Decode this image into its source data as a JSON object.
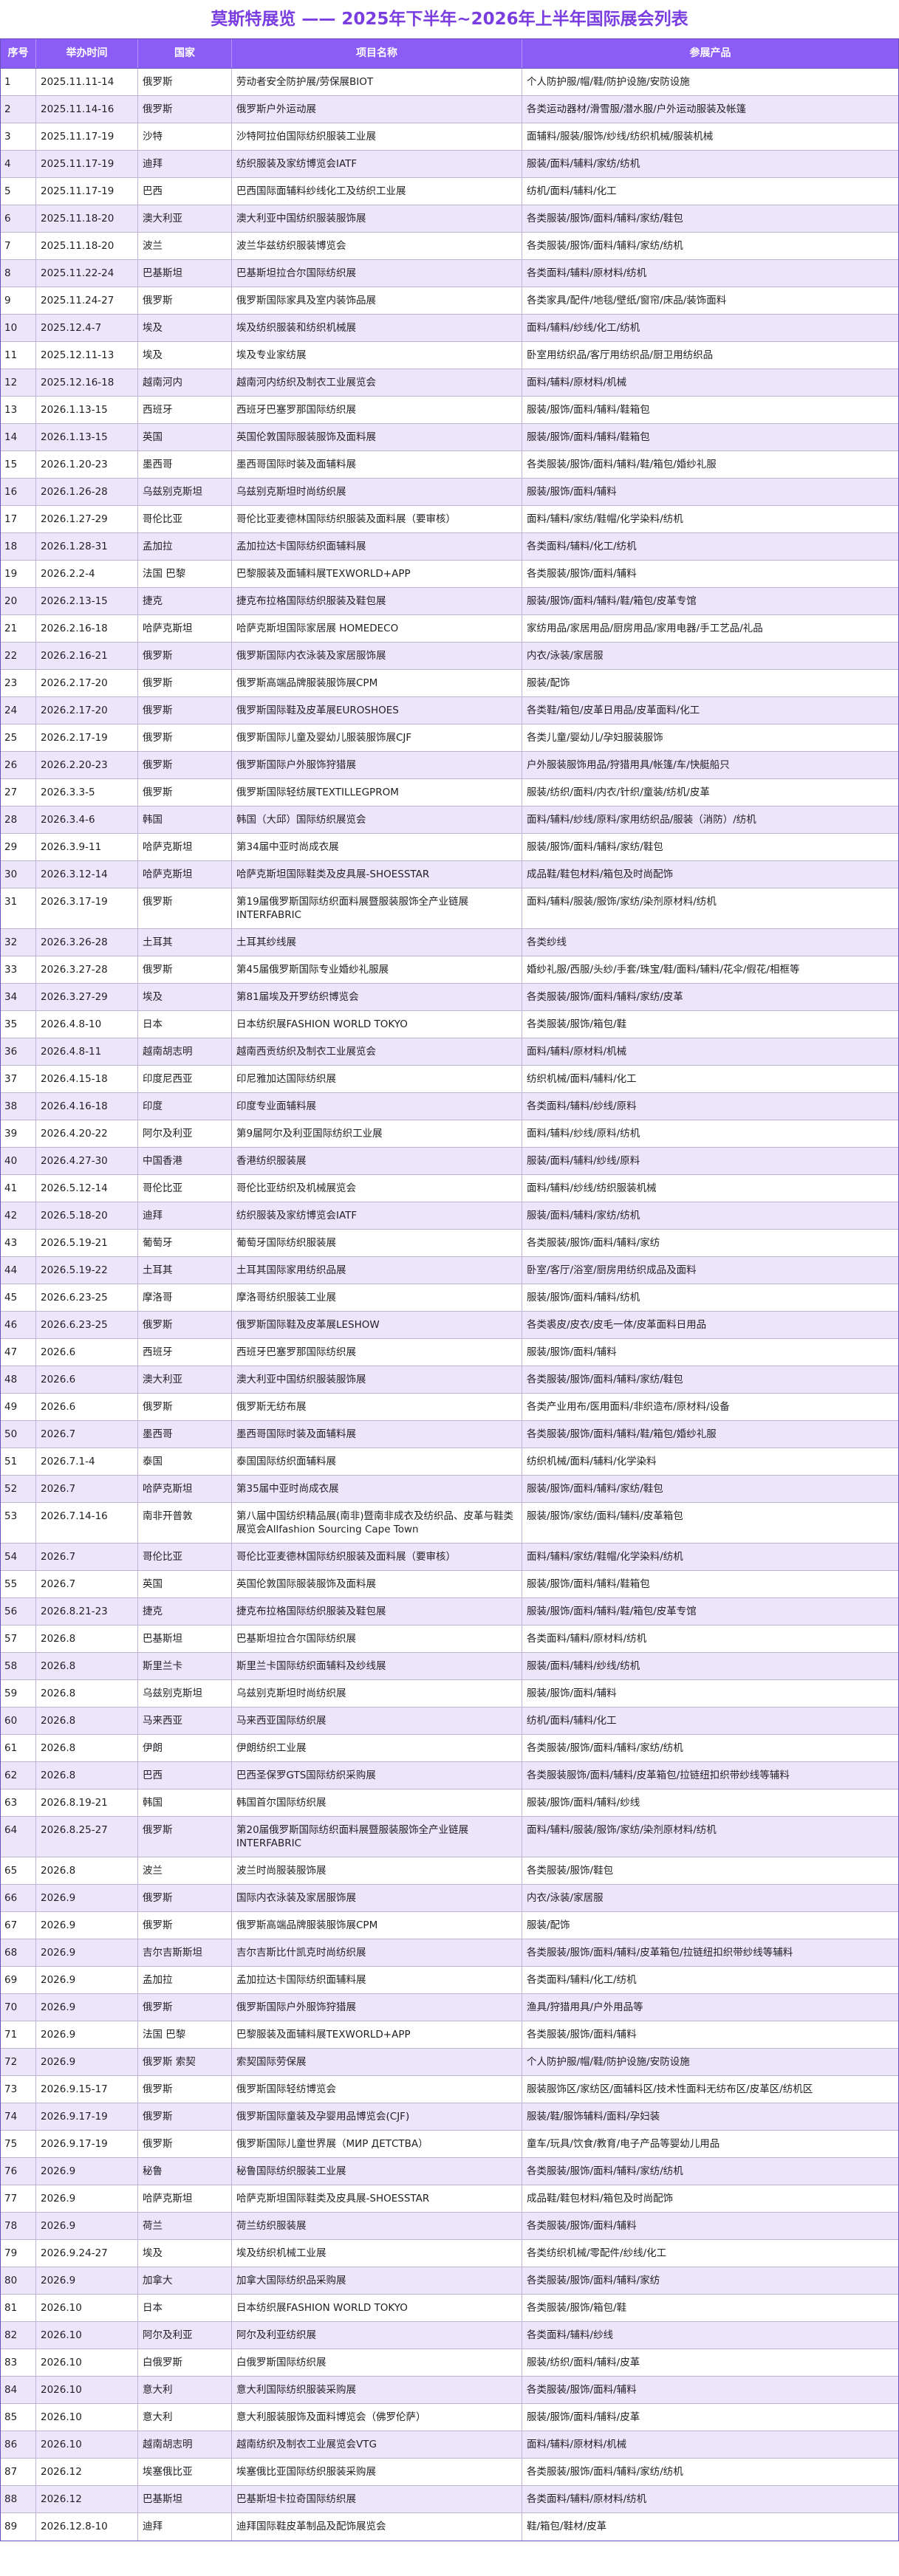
{
  "page": {
    "title": "莫斯特展览 —— 2025年下半年~2026年上半年国际展会列表"
  },
  "colors": {
    "title": "#7a3de0",
    "header_bg": "#8b5cf6",
    "header_text": "#ffffff",
    "stripe": "#ede6fb",
    "border": "#bdb3d6",
    "border_strong": "#6a4fc0"
  },
  "table": {
    "columns": [
      "序号",
      "举办时间",
      "国家",
      "项目名称",
      "参展产品"
    ],
    "rows": [
      [
        "1",
        "2025.11.11-14",
        "俄罗斯",
        "劳动者安全防护展/劳保展BIOT",
        "个人防护服/帽/鞋/防护设施/安防设施"
      ],
      [
        "2",
        "2025.11.14-16",
        "俄罗斯",
        "俄罗斯户外运动展",
        "各类运动器材/滑雪服/潜水服/户外运动服装及帐篷"
      ],
      [
        "3",
        "2025.11.17-19",
        "沙特",
        "沙特阿拉伯国际纺织服装工业展",
        "面辅料/服装/服饰/纱线/纺织机械/服装机械"
      ],
      [
        "4",
        "2025.11.17-19",
        "迪拜",
        "纺织服装及家纺博览会IATF",
        "服装/面料/辅料/家纺/纺机"
      ],
      [
        "5",
        "2025.11.17-19",
        "巴西",
        "巴西国际面辅料纱线化工及纺织工业展",
        "纺机/面料/辅料/化工"
      ],
      [
        "6",
        "2025.11.18-20",
        "澳大利亚",
        "澳大利亚中国纺织服装服饰展",
        "各类服装/服饰/面料/辅料/家纺/鞋包"
      ],
      [
        "7",
        "2025.11.18-20",
        "波兰",
        "波兰华兹纺织服装博览会",
        "各类服装/服饰/面料/辅料/家纺/纺机"
      ],
      [
        "8",
        "2025.11.22-24",
        "巴基斯坦",
        "巴基斯坦拉合尔国际纺织展",
        "各类面料/辅料/原材料/纺机"
      ],
      [
        "9",
        "2025.11.24-27",
        "俄罗斯",
        "俄罗斯国际家具及室内装饰品展",
        "各类家具/配件/地毯/壁纸/窗帘/床品/装饰面料"
      ],
      [
        "10",
        "2025.12.4-7",
        "埃及",
        "埃及纺织服装和纺织机械展",
        "面料/辅料/纱线/化工/纺机"
      ],
      [
        "11",
        "2025.12.11-13",
        "埃及",
        "埃及专业家纺展",
        "卧室用纺织品/客厅用纺织品/厨卫用纺织品"
      ],
      [
        "12",
        "2025.12.16-18",
        "越南河内",
        "越南河内纺织及制衣工业展览会",
        "面料/辅料/原材料/机械"
      ],
      [
        "13",
        "2026.1.13-15",
        "西班牙",
        "西班牙巴塞罗那国际纺织展",
        "服装/服饰/面料/辅料/鞋箱包"
      ],
      [
        "14",
        "2026.1.13-15",
        "英国",
        "英国伦敦国际服装服饰及面料展",
        "服装/服饰/面料/辅料/鞋箱包"
      ],
      [
        "15",
        "2026.1.20-23",
        "墨西哥",
        "墨西哥国际时装及面辅料展",
        "各类服装/服饰/面料/辅料/鞋/箱包/婚纱礼服"
      ],
      [
        "16",
        "2026.1.26-28",
        "乌兹别克斯坦",
        "乌兹别克斯坦时尚纺织展",
        "服装/服饰/面料/辅料"
      ],
      [
        "17",
        "2026.1.27-29",
        "哥伦比亚",
        "哥伦比亚麦德林国际纺织服装及面料展（要审核）",
        "面料/辅料/家纺/鞋帽/化学染料/纺机"
      ],
      [
        "18",
        "2026.1.28-31",
        "孟加拉",
        "孟加拉达卡国际纺织面辅料展",
        "各类面料/辅料/化工/纺机"
      ],
      [
        "19",
        "2026.2.2-4",
        "法国 巴黎",
        "巴黎服装及面辅料展TEXWORLD+APP",
        "各类服装/服饰/面料/辅料"
      ],
      [
        "20",
        "2026.2.13-15",
        "捷克",
        "捷克布拉格国际纺织服装及鞋包展",
        "服装/服饰/面料/辅料/鞋/箱包/皮革专馆"
      ],
      [
        "21",
        "2026.2.16-18",
        "哈萨克斯坦",
        "哈萨克斯坦国际家居展 HOMEDECO",
        "家纺用品/家居用品/厨房用品/家用电器/手工艺品/礼品"
      ],
      [
        "22",
        "2026.2.16-21",
        "俄罗斯",
        "俄罗斯国际内衣泳装及家居服饰展",
        "内衣/泳装/家居服"
      ],
      [
        "23",
        "2026.2.17-20",
        "俄罗斯",
        "俄罗斯高端品牌服装服饰展CPM",
        "服装/配饰"
      ],
      [
        "24",
        "2026.2.17-20",
        "俄罗斯",
        "俄罗斯国际鞋及皮革展EUROSHOES",
        "各类鞋/箱包/皮革日用品/皮革面料/化工"
      ],
      [
        "25",
        "2026.2.17-19",
        "俄罗斯",
        "俄罗斯国际儿童及婴幼儿服装服饰展CJF",
        "各类儿童/婴幼儿/孕妇服装服饰"
      ],
      [
        "26",
        "2026.2.20-23",
        "俄罗斯",
        "俄罗斯国际户外服饰狩猎展",
        "户外服装服饰用品/狩猎用具/帐篷/车/快艇船只"
      ],
      [
        "27",
        "2026.3.3-5",
        "俄罗斯",
        "俄罗斯国际轻纺展TEXTILLEGPROM",
        "服装/纺织/面料/内衣/针织/童装/纺机/皮革"
      ],
      [
        "28",
        "2026.3.4-6",
        "韩国",
        "韩国（大邱）国际纺织展览会",
        "面料/辅料/纱线/原料/家用纺织品/服装（消防）/纺机"
      ],
      [
        "29",
        "2026.3.9-11",
        "哈萨克斯坦",
        "第34届中亚时尚成衣展",
        "服装/服饰/面料/辅料/家纺/鞋包"
      ],
      [
        "30",
        "2026.3.12-14",
        "哈萨克斯坦",
        "哈萨克斯坦国际鞋类及皮具展-SHOESSTAR",
        "成品鞋/鞋包材料/箱包及时尚配饰"
      ],
      [
        "31",
        "2026.3.17-19",
        "俄罗斯",
        "第19届俄罗斯国际纺织面料展暨服装服饰全产业链展INTERFABRIC",
        "面料/辅料/服装/服饰/家纺/染剂原材料/纺机"
      ],
      [
        "32",
        "2026.3.26-28",
        "土耳其",
        "土耳其纱线展",
        "各类纱线"
      ],
      [
        "33",
        "2026.3.27-28",
        "俄罗斯",
        "第45届俄罗斯国际专业婚纱礼服展",
        "婚纱礼服/西服/头纱/手套/珠宝/鞋/面料/辅料/花伞/假花/相框等"
      ],
      [
        "34",
        "2026.3.27-29",
        "埃及",
        "第81届埃及开罗纺织博览会",
        "各类服装/服饰/面料/辅料/家纺/皮革"
      ],
      [
        "35",
        "2026.4.8-10",
        "日本",
        "日本纺织展FASHION WORLD TOKYO",
        "各类服装/服饰/箱包/鞋"
      ],
      [
        "36",
        "2026.4.8-11",
        "越南胡志明",
        "越南西贡纺织及制衣工业展览会",
        "面料/辅料/原材料/机械"
      ],
      [
        "37",
        "2026.4.15-18",
        "印度尼西亚",
        "印尼雅加达国际纺织展",
        "纺织机械/面料/辅料/化工"
      ],
      [
        "38",
        "2026.4.16-18",
        "印度",
        "印度专业面辅料展",
        "各类面料/辅料/纱线/原料"
      ],
      [
        "39",
        "2026.4.20-22",
        "阿尔及利亚",
        "第9届阿尔及利亚国际纺织工业展",
        "面料/辅料/纱线/原料/纺机"
      ],
      [
        "40",
        "2026.4.27-30",
        "中国香港",
        "香港纺织服装展",
        "服装/面料/辅料/纱线/原料"
      ],
      [
        "41",
        "2026.5.12-14",
        "哥伦比亚",
        "哥伦比亚纺织及机械展览会",
        "面料/辅料/纱线/纺织服装机械"
      ],
      [
        "42",
        "2026.5.18-20",
        "迪拜",
        "纺织服装及家纺博览会IATF",
        "服装/面料/辅料/家纺/纺机"
      ],
      [
        "43",
        "2026.5.19-21",
        "葡萄牙",
        "葡萄牙国际纺织服装展",
        "各类服装/服饰/面料/辅料/家纺"
      ],
      [
        "44",
        "2026.5.19-22",
        "土耳其",
        "土耳其国际家用纺织品展",
        "卧室/客厅/浴室/厨房用纺织成品及面料"
      ],
      [
        "45",
        "2026.6.23-25",
        "摩洛哥",
        "摩洛哥纺织服装工业展",
        "服装/服饰/面料/辅料/纺机"
      ],
      [
        "46",
        "2026.6.23-25",
        "俄罗斯",
        "俄罗斯国际鞋及皮革展LESHOW",
        "各类裘皮/皮衣/皮毛一体/皮革面料日用品"
      ],
      [
        "47",
        "2026.6",
        "西班牙",
        "西班牙巴塞罗那国际纺织展",
        "服装/服饰/面料/辅料"
      ],
      [
        "48",
        "2026.6",
        "澳大利亚",
        "澳大利亚中国纺织服装服饰展",
        "各类服装/服饰/面料/辅料/家纺/鞋包"
      ],
      [
        "49",
        "2026.6",
        "俄罗斯",
        "俄罗斯无纺布展",
        "各类产业用布/医用面料/非织造布/原材料/设备"
      ],
      [
        "50",
        "2026.7",
        "墨西哥",
        "墨西哥国际时装及面辅料展",
        "各类服装/服饰/面料/辅料/鞋/箱包/婚纱礼服"
      ],
      [
        "51",
        "2026.7.1-4",
        "泰国",
        "泰国国际纺织面辅料展",
        "纺织机械/面料/辅料/化学染料"
      ],
      [
        "52",
        "2026.7",
        "哈萨克斯坦",
        "第35届中亚时尚成衣展",
        "服装/服饰/面料/辅料/家纺/鞋包"
      ],
      [
        "53",
        "2026.7.14-16",
        "南非开普敦",
        "第八届中国纺织精品展(南非)暨南非成衣及纺织品、皮革与鞋类展览会Allfashion Sourcing Cape Town",
        "服装/服饰/家纺/面料/辅料/皮革箱包"
      ],
      [
        "54",
        "2026.7",
        "哥伦比亚",
        "哥伦比亚麦德林国际纺织服装及面料展（要审核）",
        "面料/辅料/家纺/鞋帽/化学染料/纺机"
      ],
      [
        "55",
        "2026.7",
        "英国",
        "英国伦敦国际服装服饰及面料展",
        "服装/服饰/面料/辅料/鞋箱包"
      ],
      [
        "56",
        "2026.8.21-23",
        "捷克",
        "捷克布拉格国际纺织服装及鞋包展",
        "服装/服饰/面料/辅料/鞋/箱包/皮革专馆"
      ],
      [
        "57",
        "2026.8",
        "巴基斯坦",
        "巴基斯坦拉合尔国际纺织展",
        "各类面料/辅料/原材料/纺机"
      ],
      [
        "58",
        "2026.8",
        "斯里兰卡",
        "斯里兰卡国际纺织面辅料及纱线展",
        "服装/面料/辅料/纱线/纺机"
      ],
      [
        "59",
        "2026.8",
        "乌兹别克斯坦",
        "乌兹别克斯坦时尚纺织展",
        "服装/服饰/面料/辅料"
      ],
      [
        "60",
        "2026.8",
        "马来西亚",
        "马来西亚国际纺织展",
        "纺机/面料/辅料/化工"
      ],
      [
        "61",
        "2026.8",
        "伊朗",
        "伊朗纺织工业展",
        "各类服装/服饰/面料/辅料/家纺/纺机"
      ],
      [
        "62",
        "2026.8",
        "巴西",
        "巴西圣保罗GTS国际纺织采购展",
        "各类服装服饰/面料/辅料/皮革箱包/拉链纽扣织带纱线等辅料"
      ],
      [
        "63",
        "2026.8.19-21",
        "韩国",
        "韩国首尔国际纺织展",
        "服装/服饰/面料/辅料/纱线"
      ],
      [
        "64",
        "2026.8.25-27",
        "俄罗斯",
        "第20届俄罗斯国际纺织面料展暨服装服饰全产业链展INTERFABRIC",
        "面料/辅料/服装/服饰/家纺/染剂原材料/纺机"
      ],
      [
        "65",
        "2026.8",
        "波兰",
        "波兰时尚服装服饰展",
        "各类服装/服饰/鞋包"
      ],
      [
        "66",
        "2026.9",
        "俄罗斯",
        "国际内衣泳装及家居服饰展",
        "内衣/泳装/家居服"
      ],
      [
        "67",
        "2026.9",
        "俄罗斯",
        "俄罗斯高端品牌服装服饰展CPM",
        "服装/配饰"
      ],
      [
        "68",
        "2026.9",
        "吉尔吉斯斯坦",
        "吉尔吉斯比什凯克时尚纺织展",
        "各类服装/服饰/面料/辅料/皮革箱包/拉链纽扣织带纱线等辅料"
      ],
      [
        "69",
        "2026.9",
        "孟加拉",
        "孟加拉达卡国际纺织面辅料展",
        "各类面料/辅料/化工/纺机"
      ],
      [
        "70",
        "2026.9",
        "俄罗斯",
        "俄罗斯国际户外服饰狩猎展",
        "渔具/狩猎用具/户外用品等"
      ],
      [
        "71",
        "2026.9",
        "法国 巴黎",
        "巴黎服装及面辅料展TEXWORLD+APP",
        "各类服装/服饰/面料/辅料"
      ],
      [
        "72",
        "2026.9",
        "俄罗斯 索契",
        "索契国际劳保展",
        "个人防护服/帽/鞋/防护设施/安防设施"
      ],
      [
        "73",
        "2026.9.15-17",
        "俄罗斯",
        "俄罗斯国际轻纺博览会",
        "服装服饰区/家纺区/面辅料区/技术性面料无纺布区/皮革区/纺机区"
      ],
      [
        "74",
        "2026.9.17-19",
        "俄罗斯",
        "俄罗斯国际童装及孕婴用品博览会(CJF)",
        "服装/鞋/服饰辅料/面料/孕妇装"
      ],
      [
        "75",
        "2026.9.17-19",
        "俄罗斯",
        "俄罗斯国际儿童世界展（МИР ДЕТСТВА）",
        "童车/玩具/饮食/教育/电子产品等婴幼儿用品"
      ],
      [
        "76",
        "2026.9",
        "秘鲁",
        "秘鲁国际纺织服装工业展",
        "各类服装/服饰/面料/辅料/家纺/纺机"
      ],
      [
        "77",
        "2026.9",
        "哈萨克斯坦",
        "哈萨克斯坦国际鞋类及皮具展-SHOESSTAR",
        "成品鞋/鞋包材料/箱包及时尚配饰"
      ],
      [
        "78",
        "2026.9",
        "荷兰",
        "荷兰纺织服装展",
        "各类服装/服饰/面料/辅料"
      ],
      [
        "79",
        "2026.9.24-27",
        "埃及",
        "埃及纺织机械工业展",
        "各类纺织机械/零配件/纱线/化工"
      ],
      [
        "80",
        "2026.9",
        "加拿大",
        "加拿大国际纺织品采购展",
        "各类服装/服饰/面料/辅料/家纺"
      ],
      [
        "81",
        "2026.10",
        "日本",
        "日本纺织展FASHION WORLD TOKYO",
        "各类服装/服饰/箱包/鞋"
      ],
      [
        "82",
        "2026.10",
        "阿尔及利亚",
        "阿尔及利亚纺织展",
        "各类面料/辅料/纱线"
      ],
      [
        "83",
        "2026.10",
        "白俄罗斯",
        "白俄罗斯国际纺织展",
        "服装/纺织/面料/辅料/皮革"
      ],
      [
        "84",
        "2026.10",
        "意大利",
        "意大利国际纺织服装采购展",
        "各类服装/服饰/面料/辅料"
      ],
      [
        "85",
        "2026.10",
        "意大利",
        "意大利服装服饰及面料博览会（佛罗伦萨）",
        "服装/服饰/面料/辅料/皮革"
      ],
      [
        "86",
        "2026.10",
        "越南胡志明",
        "越南纺织及制衣工业展览会VTG",
        "面料/辅料/原材料/机械"
      ],
      [
        "87",
        "2026.12",
        "埃塞俄比亚",
        "埃塞俄比亚国际纺织服装采购展",
        "各类服装/服饰/面料/辅料/家纺/纺机"
      ],
      [
        "88",
        "2026.12",
        "巴基斯坦",
        "巴基斯坦卡拉奇国际纺织展",
        "各类面料/辅料/原材料/纺机"
      ],
      [
        "89",
        "2026.12.8-10",
        "迪拜",
        "迪拜国际鞋皮革制品及配饰展览会",
        "鞋/箱包/鞋材/皮革"
      ]
    ]
  }
}
